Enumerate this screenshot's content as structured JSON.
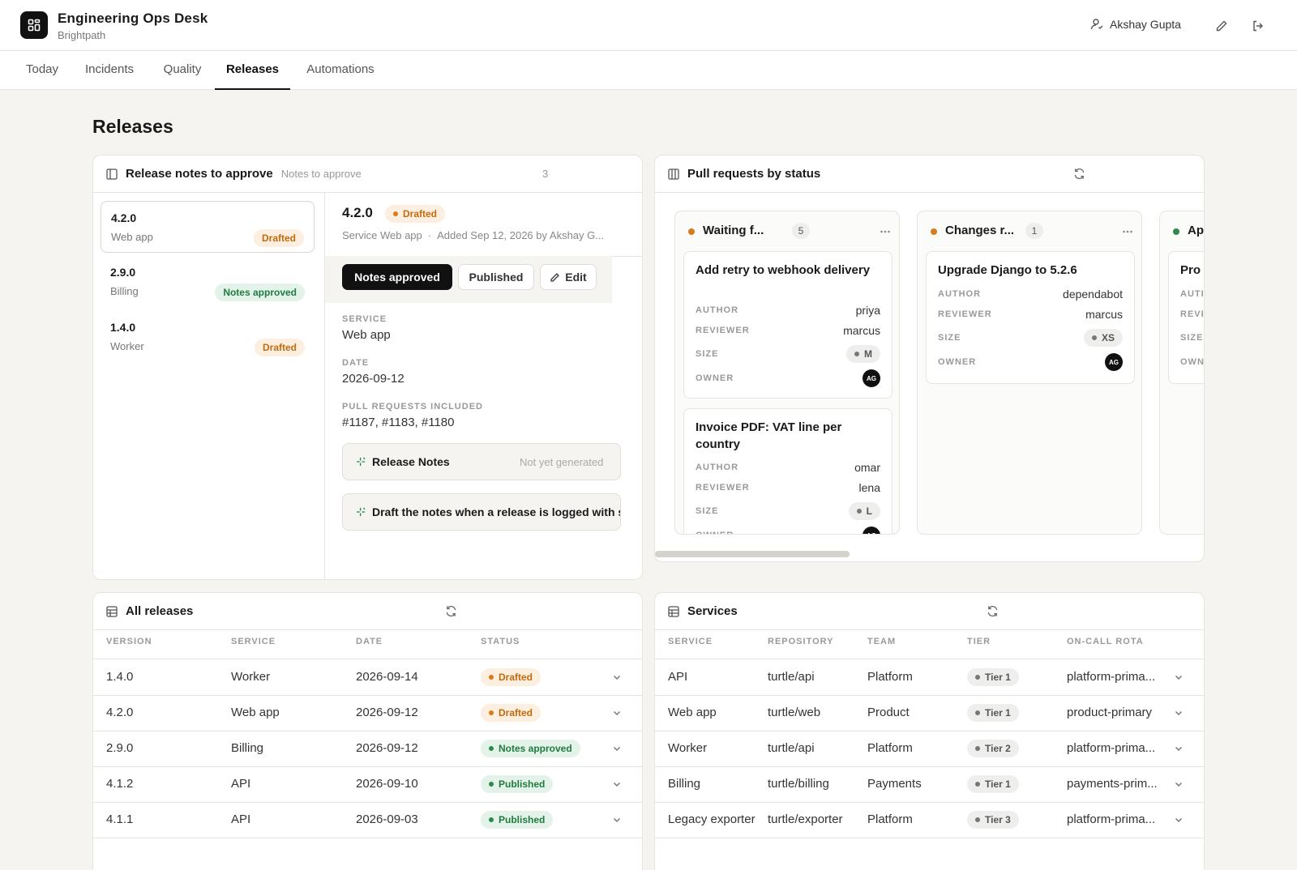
{
  "header": {
    "app_title": "Engineering Ops Desk",
    "app_subtitle": "Brightpath",
    "user_name": "Akshay Gupta"
  },
  "tabs": [
    "Today",
    "Incidents",
    "Quality",
    "Releases",
    "Automations"
  ],
  "active_tab": "Releases",
  "page_title": "Releases",
  "release_notes": {
    "title": "Release notes to approve",
    "subtitle": "Notes to approve",
    "count": "3",
    "items": [
      {
        "version": "4.2.0",
        "service": "Web app",
        "status": "Drafted"
      },
      {
        "version": "2.9.0",
        "service": "Billing",
        "status": "Notes approved"
      },
      {
        "version": "1.4.0",
        "service": "Worker",
        "status": "Drafted"
      }
    ],
    "detail": {
      "version": "4.2.0",
      "status": "Drafted",
      "meta_service": "Service Web app",
      "meta_added": "Added Sep 12, 2026 by Akshay G...",
      "actions": {
        "approve": "Notes approved",
        "publish": "Published",
        "edit": "Edit"
      },
      "service_label": "SERVICE",
      "service": "Web app",
      "date_label": "DATE",
      "date": "2026-09-12",
      "prs_label": "PULL REQUESTS INCLUDED",
      "prs": "#1187, #1183, #1180",
      "notes_box_title": "Release Notes",
      "notes_box_status": "Not yet generated",
      "automation_text": "Draft the notes when a release is logged with statusN"
    }
  },
  "pull_requests": {
    "title": "Pull requests by status",
    "columns": [
      {
        "title": "Waiting f...",
        "count": "5",
        "color": "#d97a1c",
        "cards": [
          {
            "title": "Add retry to webhook delivery",
            "author": "priya",
            "reviewer": "marcus",
            "size": "M",
            "owner": "AG"
          },
          {
            "title": "Invoice PDF: VAT line per country",
            "author": "omar",
            "reviewer": "lena",
            "size": "L",
            "owner": "AG"
          }
        ]
      },
      {
        "title": "Changes r...",
        "count": "1",
        "color": "#d97a1c",
        "cards": [
          {
            "title": "Upgrade Django to 5.2.6",
            "author": "dependabot",
            "reviewer": "marcus",
            "size": "XS",
            "owner": "AG"
          }
        ]
      },
      {
        "title": "Ap",
        "count": "",
        "color": "#2e8a4c",
        "cards": [
          {
            "title": "Pro",
            "author": "",
            "reviewer": "",
            "size": "",
            "owner": ""
          }
        ]
      }
    ],
    "labels": {
      "author": "AUTHOR",
      "reviewer": "REVIEWER",
      "size": "SIZE",
      "owner": "OWNER"
    },
    "label_stubs": {
      "author": "AUTI",
      "reviewer": "REVI",
      "size": "SIZE",
      "owner": "OWN"
    }
  },
  "all_releases": {
    "title": "All releases",
    "columns": [
      "VERSION",
      "SERVICE",
      "DATE",
      "STATUS"
    ],
    "rows": [
      {
        "version": "1.4.0",
        "service": "Worker",
        "date": "2026-09-14",
        "status": "Drafted"
      },
      {
        "version": "4.2.0",
        "service": "Web app",
        "date": "2026-09-12",
        "status": "Drafted"
      },
      {
        "version": "2.9.0",
        "service": "Billing",
        "date": "2026-09-12",
        "status": "Notes approved"
      },
      {
        "version": "4.1.2",
        "service": "API",
        "date": "2026-09-10",
        "status": "Published"
      },
      {
        "version": "4.1.1",
        "service": "API",
        "date": "2026-09-03",
        "status": "Published"
      }
    ]
  },
  "services": {
    "title": "Services",
    "columns": [
      "SERVICE",
      "REPOSITORY",
      "TEAM",
      "TIER",
      "ON-CALL ROTA"
    ],
    "rows": [
      {
        "service": "API",
        "repo": "turtle/api",
        "team": "Platform",
        "tier": "Tier 1",
        "rota": "platform-prima..."
      },
      {
        "service": "Web app",
        "repo": "turtle/web",
        "team": "Product",
        "tier": "Tier 1",
        "rota": "product-primary"
      },
      {
        "service": "Worker",
        "repo": "turtle/api",
        "team": "Platform",
        "tier": "Tier 2",
        "rota": "platform-prima..."
      },
      {
        "service": "Billing",
        "repo": "turtle/billing",
        "team": "Payments",
        "tier": "Tier 1",
        "rota": "payments-prim..."
      },
      {
        "service": "Legacy exporter",
        "repo": "turtle/exporter",
        "team": "Platform",
        "tier": "Tier 3",
        "rota": "platform-prima..."
      }
    ]
  }
}
